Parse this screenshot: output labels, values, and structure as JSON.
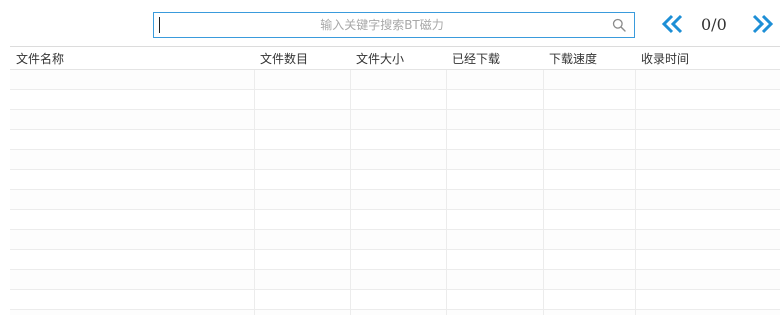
{
  "search": {
    "placeholder": "输入关键字搜索BT磁力",
    "value": ""
  },
  "pagination": {
    "current_label": "0/0",
    "prev_icon": "double-chevron-left-icon",
    "next_icon": "double-chevron-right-icon"
  },
  "table": {
    "columns": [
      {
        "label": "文件名称"
      },
      {
        "label": "文件数目"
      },
      {
        "label": "文件大小"
      },
      {
        "label": "已经下载"
      },
      {
        "label": "下载速度"
      },
      {
        "label": "收录时间"
      }
    ],
    "rows": []
  },
  "colors": {
    "accent": "#3a9bdc",
    "nav_arrow": "#1e8fd6",
    "text": "#333333",
    "placeholder": "#a8a8a8",
    "grid": "#ececec"
  },
  "icons": {
    "search": "search-icon"
  }
}
